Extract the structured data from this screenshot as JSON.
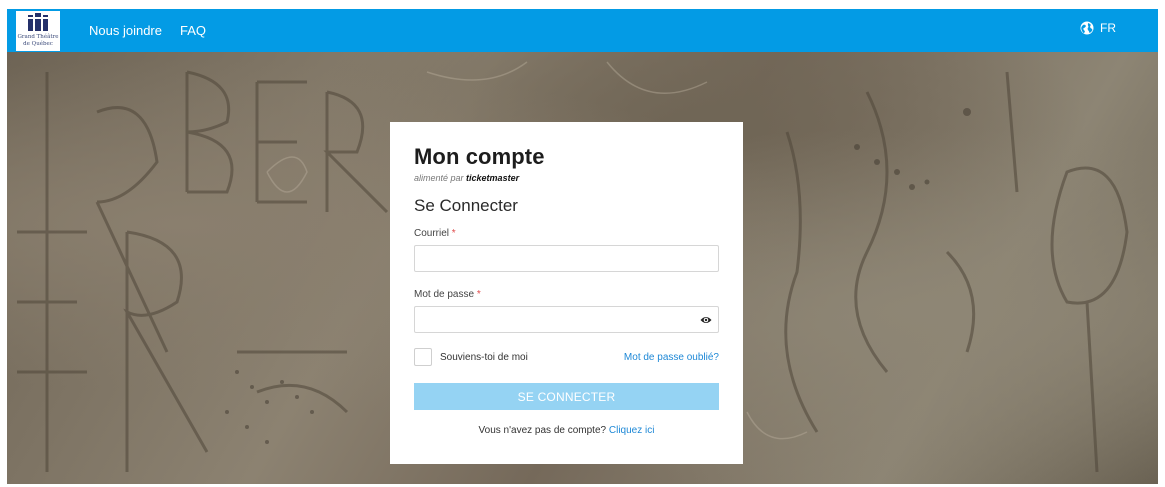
{
  "header": {
    "logo_line1": "Grand Théâtre",
    "logo_line2": "de Québec",
    "nav": [
      {
        "label": "Nous joindre"
      },
      {
        "label": "FAQ"
      }
    ],
    "language": "FR",
    "language_icon": "globe-icon",
    "accent_color": "#039be5"
  },
  "card": {
    "title": "Mon compte",
    "powered_prefix": "alimenté par",
    "powered_brand": "ticketmaster",
    "subtitle": "Se Connecter",
    "email_label": "Courriel",
    "email_value": "",
    "password_label": "Mot de passe",
    "password_value": "",
    "required_marker": "*",
    "show_password_icon": "eye-icon",
    "remember_label": "Souviens-toi de moi",
    "forgot_label": "Mot de passe oublié?",
    "submit_label": "SE CONNECTER",
    "signup_text": "Vous n'avez pas de compte?",
    "signup_link": "Cliquez ici",
    "link_color": "#1e88d6",
    "button_color": "#95d3f3"
  }
}
